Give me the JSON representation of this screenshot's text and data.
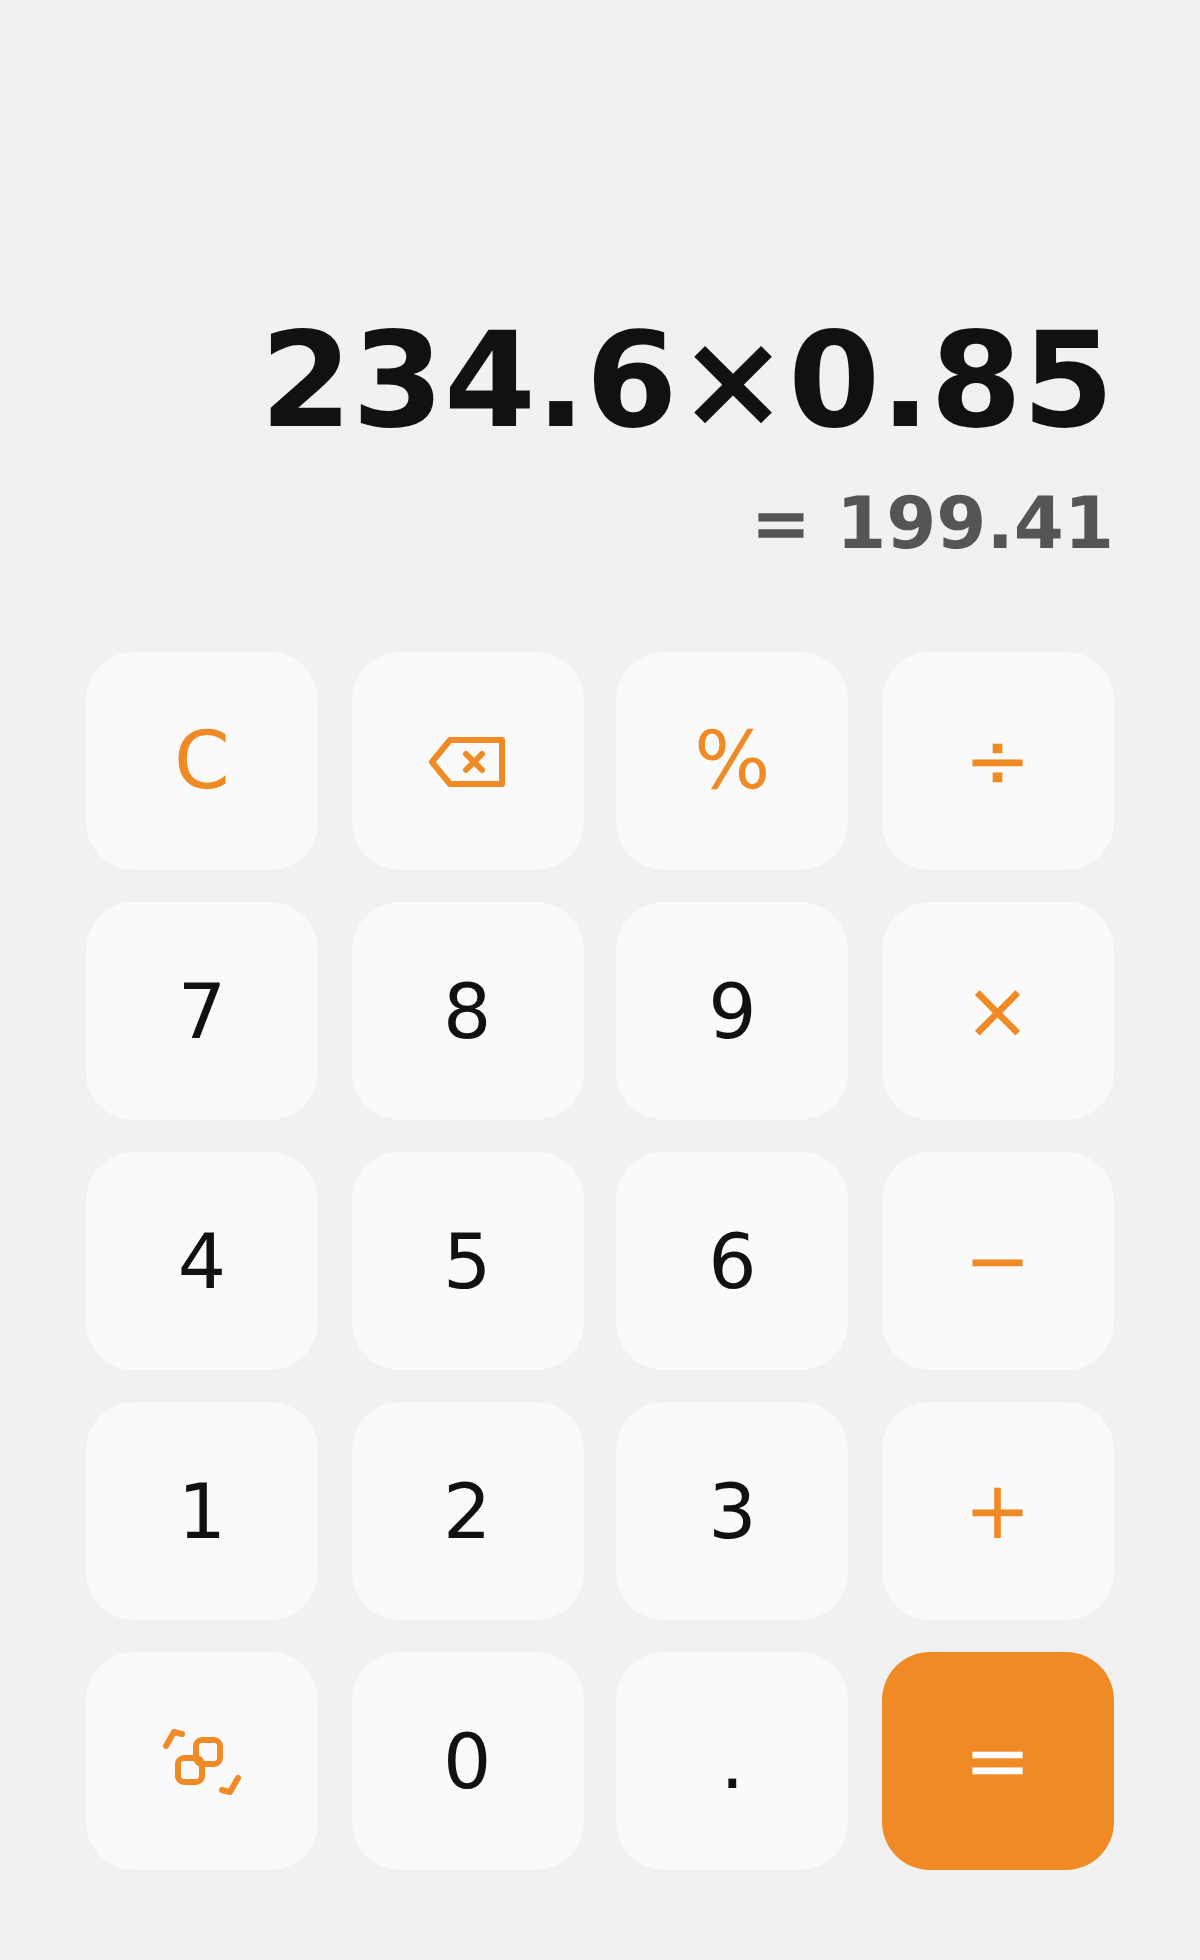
{
  "display": {
    "expression": "234.6×0.85",
    "result": "= 199.41"
  },
  "keys": [
    {
      "kind": "operator",
      "label": "C"
    },
    {
      "kind": "backspace"
    },
    {
      "kind": "operator",
      "label": "%"
    },
    {
      "kind": "operator",
      "label": "÷"
    },
    {
      "kind": "digit",
      "label": "7"
    },
    {
      "kind": "digit",
      "label": "8"
    },
    {
      "kind": "digit",
      "label": "9"
    },
    {
      "kind": "operator",
      "label": "×"
    },
    {
      "kind": "digit",
      "label": "4"
    },
    {
      "kind": "digit",
      "label": "5"
    },
    {
      "kind": "digit",
      "label": "6"
    },
    {
      "kind": "operator",
      "label": "−"
    },
    {
      "kind": "digit",
      "label": "1"
    },
    {
      "kind": "digit",
      "label": "2"
    },
    {
      "kind": "digit",
      "label": "3"
    },
    {
      "kind": "operator",
      "label": "+"
    },
    {
      "kind": "convert"
    },
    {
      "kind": "digit",
      "label": "0"
    },
    {
      "kind": "digit",
      "label": "."
    },
    {
      "kind": "equals",
      "label": "="
    }
  ]
}
